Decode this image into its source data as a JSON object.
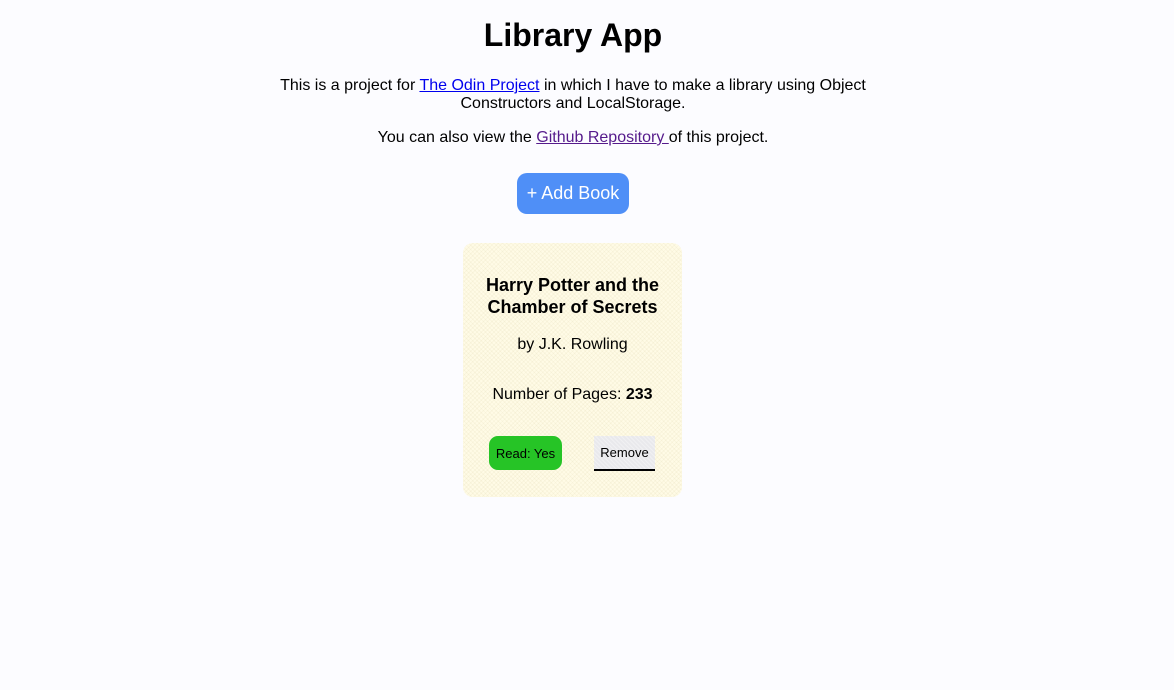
{
  "header": {
    "title": "Library App"
  },
  "intro": {
    "text_before_link": "This is a project for ",
    "odin_link_label": "The Odin Project",
    "text_after_link": " in which I have to make a library using Object Constructors and LocalStorage."
  },
  "repo": {
    "text_before_link": "You can also view the ",
    "repo_link_label": "Github Repository ",
    "text_after_link": "of this project."
  },
  "toolbar": {
    "add_book_label": "+ Add Book"
  },
  "books": [
    {
      "title": "Harry Potter and the Chamber of Secrets",
      "author_line": "by J.K. Rowling",
      "pages_label": "Number of Pages: ",
      "pages_value": "233",
      "read_label": "Read: Yes",
      "remove_label": "Remove"
    }
  ],
  "colors": {
    "accent": "#4f8ff7",
    "read_yes": "#26c426",
    "card_background": "#fffbe6"
  }
}
